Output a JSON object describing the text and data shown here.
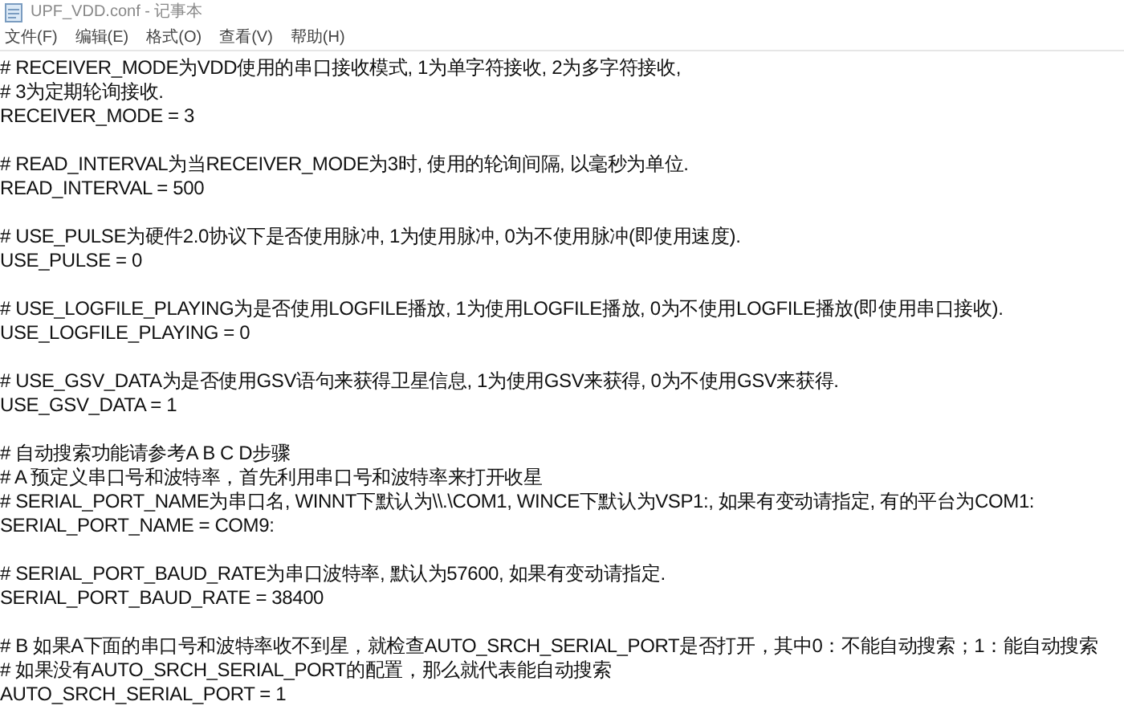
{
  "window": {
    "title": "UPF_VDD.conf - 记事本"
  },
  "menu": [
    "文件(F)",
    "编辑(E)",
    "格式(O)",
    "查看(V)",
    "帮助(H)"
  ],
  "editor": {
    "blocks": [
      [
        "# RECEIVER_MODE为VDD使用的串口接收模式, 1为单字符接收, 2为多字符接收,",
        "# 3为定期轮询接收.",
        "RECEIVER_MODE = 3"
      ],
      [
        "# READ_INTERVAL为当RECEIVER_MODE为3时, 使用的轮询间隔, 以毫秒为单位.",
        "READ_INTERVAL = 500"
      ],
      [
        "# USE_PULSE为硬件2.0协议下是否使用脉冲, 1为使用脉冲, 0为不使用脉冲(即使用速度).",
        "USE_PULSE = 0"
      ],
      [
        "# USE_LOGFILE_PLAYING为是否使用LOGFILE播放, 1为使用LOGFILE播放, 0为不使用LOGFILE播放(即使用串口接收).",
        "USE_LOGFILE_PLAYING = 0"
      ],
      [
        "# USE_GSV_DATA为是否使用GSV语句来获得卫星信息, 1为使用GSV来获得, 0为不使用GSV来获得.",
        "USE_GSV_DATA = 1"
      ],
      [
        "# 自动搜索功能请参考A B C D步骤",
        "# A 预定义串口号和波特率，首先利用串口号和波特率来打开收星",
        "# SERIAL_PORT_NAME为串口名, WINNT下默认为\\\\.\\COM1, WINCE下默认为VSP1:, 如果有变动请指定, 有的平台为COM1:",
        "SERIAL_PORT_NAME = COM9:"
      ],
      [
        "# SERIAL_PORT_BAUD_RATE为串口波特率, 默认为57600, 如果有变动请指定.",
        "SERIAL_PORT_BAUD_RATE = 38400"
      ],
      [
        "# B 如果A下面的串口号和波特率收不到星，就检查AUTO_SRCH_SERIAL_PORT是否打开，其中0：不能自动搜索；1：能自动搜索",
        "# 如果没有AUTO_SRCH_SERIAL_PORT的配置，那么就代表能自动搜索",
        "AUTO_SRCH_SERIAL_PORT = 1"
      ]
    ]
  }
}
